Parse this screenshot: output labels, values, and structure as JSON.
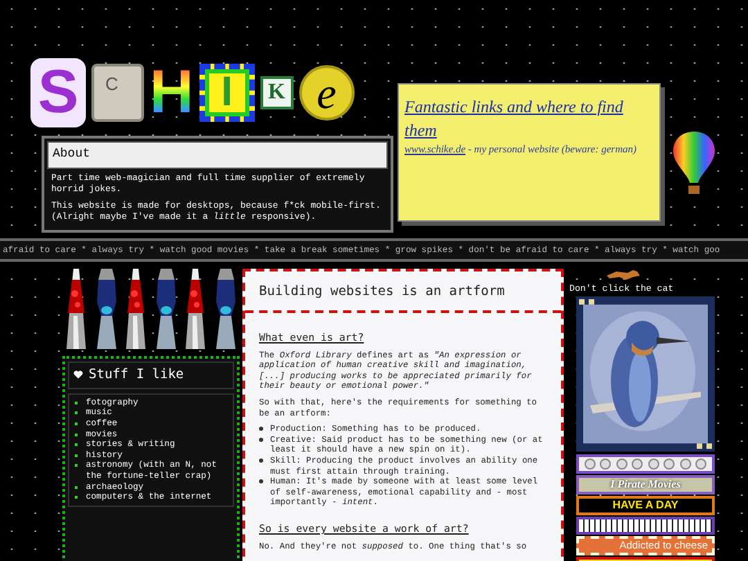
{
  "logo": {
    "letters": [
      "S",
      "C",
      "H",
      "I",
      "K",
      "e"
    ]
  },
  "about": {
    "title": "About",
    "paragraphs": [
      "Part time web-magician and full time supplier of extremely horrid jokes.",
      "This website is made for desktops, because f*ck mobile-first. (Alright maybe I've made it a *little* responsive)."
    ]
  },
  "note": {
    "title": "Fantastic links and where to find them",
    "link": "www.schike.de",
    "description": " - my personal website (beware: german)"
  },
  "marquee": "afraid to care * always try * watch good movies * take a break sometimes * grow spikes * don't be afraid to care * always try * watch goo",
  "likes": {
    "title": "Stuff I like",
    "items": [
      "fotography",
      "music",
      "coffee",
      "movies",
      "stories & writing",
      "history",
      "astronomy (with an N, not the fortune-teller crap)",
      "archaeology",
      "computers & the internet"
    ]
  },
  "article": {
    "title": "Building websites is an artform",
    "blocks": [
      {
        "kind": "heading",
        "text": "What even is art?"
      },
      {
        "kind": "paragraph",
        "text": "The *Oxford Library* defines art as *\"An expression or application of human creative skill and imagination, [...] producing works to be appreciated primarily for their beauty or emotional power.\"*"
      },
      {
        "kind": "paragraph",
        "text": "So with that, here's the requirements for something to be an artform:"
      },
      {
        "kind": "list",
        "items": [
          "Production: Something has to be produced.",
          "Creative: Said product has to be something new (or at least it should have a new spin on it).",
          "Skill: Producing the product involves an ability one must first attain through training.",
          "Human: It's made by someone with at least some level of self-awareness, emotional capability and - most importantly - *intent*."
        ]
      },
      {
        "kind": "heading",
        "text": "So is every website a work of art?"
      },
      {
        "kind": "paragraph",
        "text": "No. And they're not *supposed* to. One thing that's so"
      }
    ]
  },
  "sidebar": {
    "cat_caption": "Don't click the cat",
    "badges": [
      {
        "kind": "smileys"
      },
      {
        "kind": "pirate",
        "text": "I Pirate Movies"
      },
      {
        "kind": "day",
        "text": "HAVE A DAY"
      },
      {
        "kind": "piano"
      },
      {
        "kind": "cheese",
        "text": "Addicted to cheese"
      },
      {
        "kind": "stripe"
      }
    ]
  }
}
